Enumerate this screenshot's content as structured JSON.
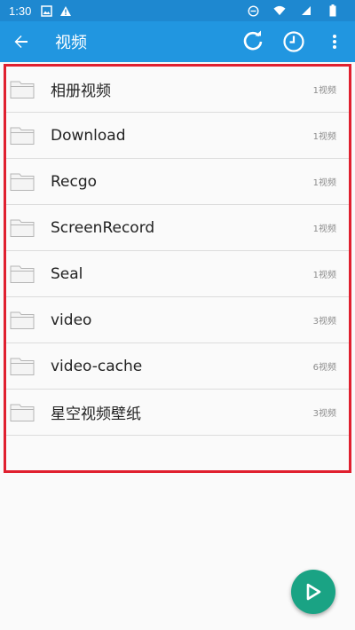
{
  "status_bar": {
    "time": "1:30",
    "icons_left": [
      "image-icon",
      "warning-icon"
    ],
    "icons_right": [
      "do-not-disturb-icon",
      "wifi-icon",
      "signal-icon",
      "battery-icon"
    ]
  },
  "app_bar": {
    "title": "视频",
    "back_icon": "arrow-back-icon",
    "actions": [
      "refresh-icon",
      "clock-icon",
      "more-vert-icon"
    ]
  },
  "folders": [
    {
      "name": "相册视频",
      "count": "1视频"
    },
    {
      "name": "Download",
      "count": "1视频"
    },
    {
      "name": "Recgo",
      "count": "1视频"
    },
    {
      "name": "ScreenRecord",
      "count": "1视频"
    },
    {
      "name": "Seal",
      "count": "1视频"
    },
    {
      "name": "video",
      "count": "3视频"
    },
    {
      "name": "video-cache",
      "count": "6视频"
    },
    {
      "name": "星空视频壁纸",
      "count": "3视频"
    }
  ],
  "fab": {
    "icon": "play-icon"
  },
  "colors": {
    "status_bar": "#1e88d0",
    "app_bar": "#2196e0",
    "highlight_border": "#e0202f",
    "fab": "#1aa384"
  }
}
